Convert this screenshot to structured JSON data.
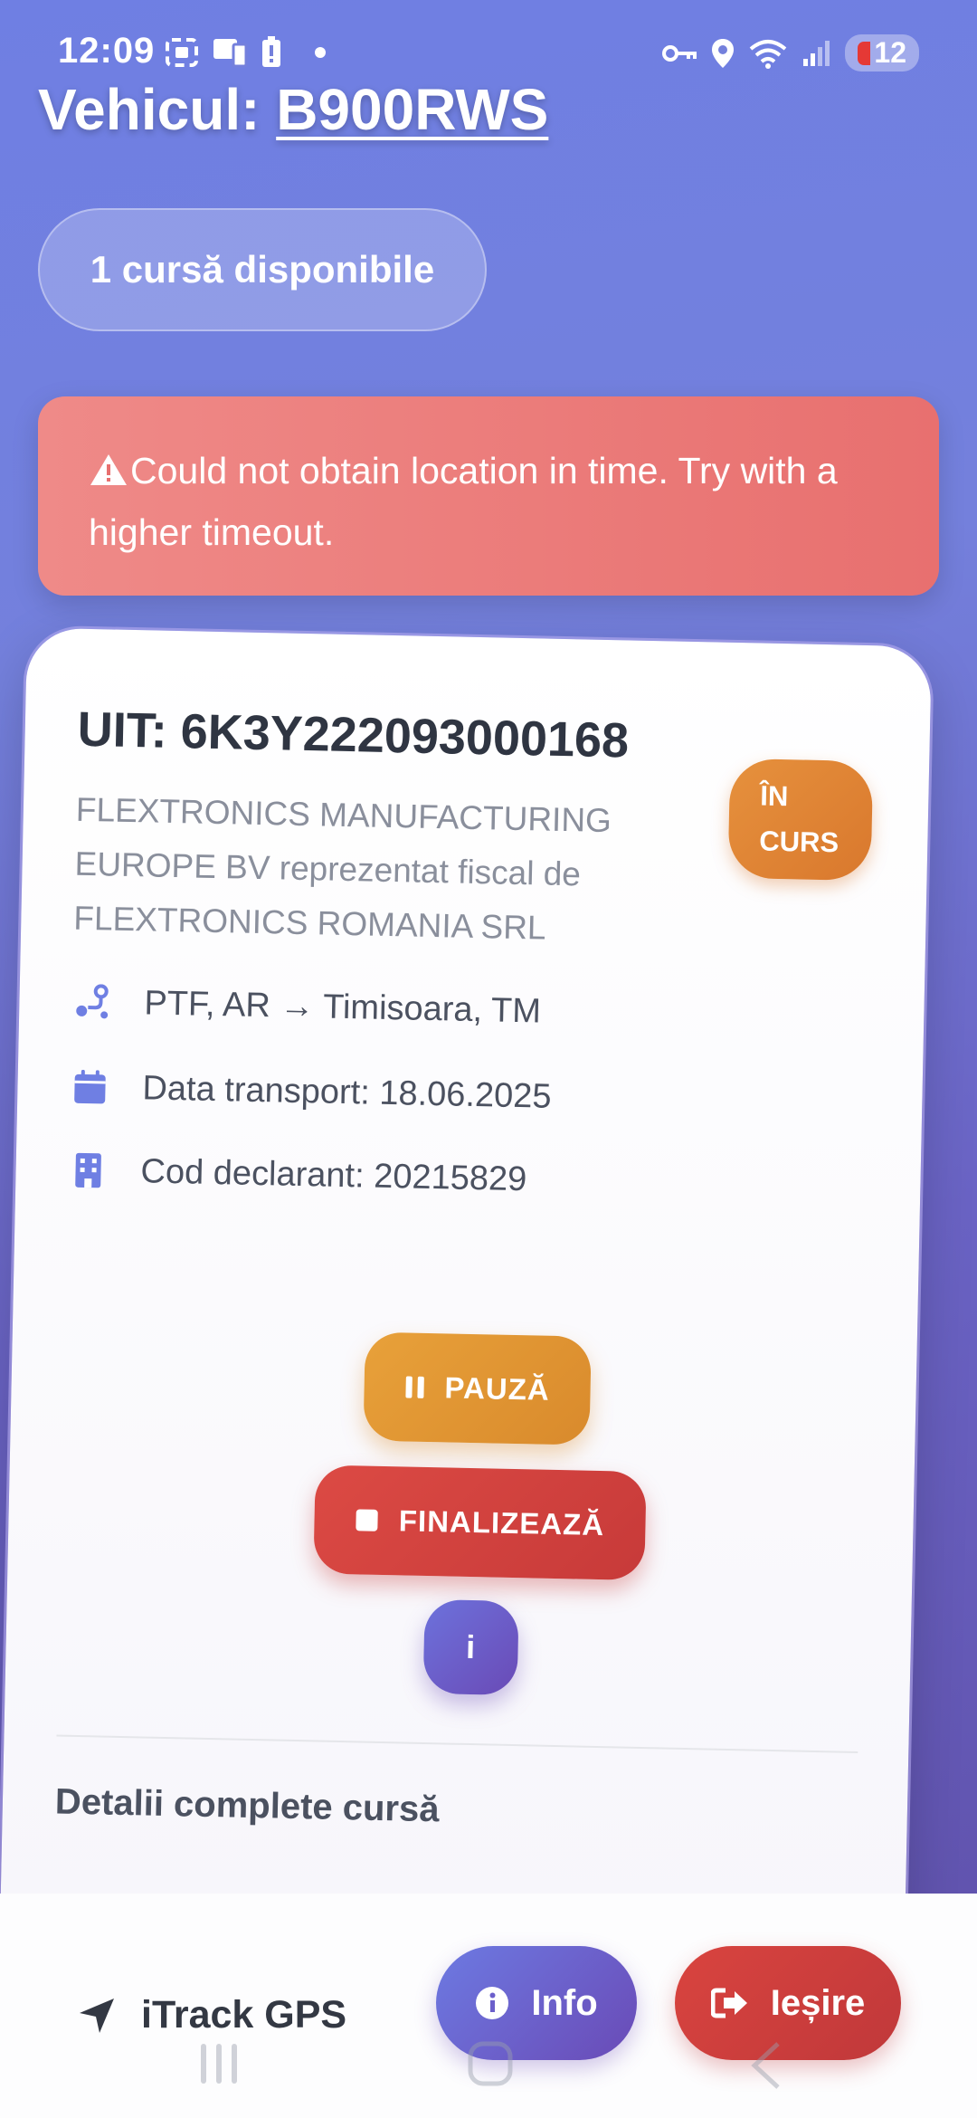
{
  "status_bar": {
    "time": "12:09",
    "battery": "12",
    "icons": [
      "screenshot-icon",
      "cast-icon",
      "battery-alert-icon",
      "dot-icon",
      "vpn-key-icon",
      "location-icon",
      "wifi-icon",
      "signal-icon"
    ]
  },
  "header": {
    "prefix": "Vehicul: ",
    "plate": "B900RWS"
  },
  "runs_pill": {
    "label": "1 cursă disponibile"
  },
  "alert": {
    "icon": "warning-icon",
    "message": "Could not obtain location in time. Try with a higher timeout."
  },
  "trip_card": {
    "uit": "UIT: 6K3Y222093000168",
    "company": "FLEXTRONICS MANUFACTURING EUROPE BV reprezentat fiscal de FLEXTRONICS ROMANIA SRL",
    "status_line1": "ÎN",
    "status_line2": "CURS",
    "route": "PTF, AR → Timisoara, TM",
    "date": "Data transport: 18.06.2025",
    "cod": "Cod declarant: 20215829",
    "pause_label": "PAUZĂ",
    "finalize_label": "FINALIZEAZĂ",
    "info_label": "i",
    "details_title": "Detalii complete cursă",
    "colors": {
      "pause": "#e09533",
      "finalize": "#d0413e",
      "status": "#e0863a"
    }
  },
  "bottom_bar": {
    "brand": "iTrack GPS",
    "info_label": "Info",
    "exit_label": "Ieșire"
  }
}
